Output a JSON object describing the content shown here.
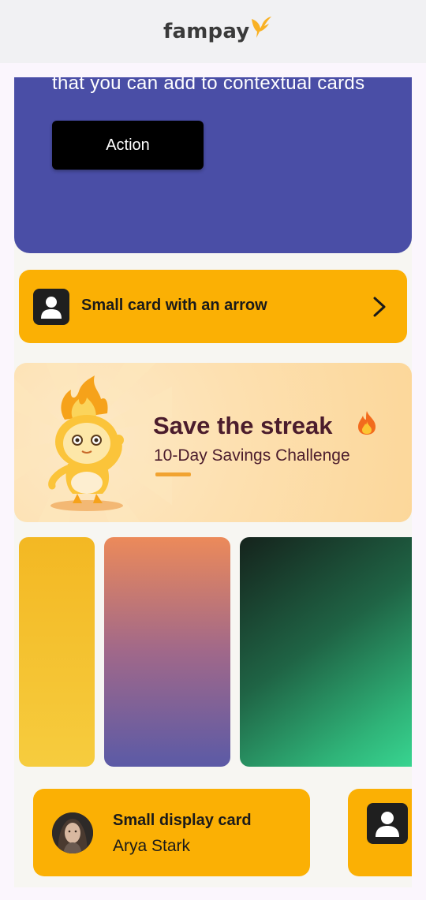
{
  "header": {
    "logo_text": "fampay",
    "logo_icon": "fampay-bird-icon",
    "accent_color": "#f9b123"
  },
  "big_display_card": {
    "text": "that you can add to contextual cards",
    "action_label": "Action",
    "background": "#4a4ea6"
  },
  "arrow_card": {
    "label": "Small card with an arrow",
    "icon": "user-icon",
    "arrow_icon": "chevron-right-icon",
    "background": "#fbb004"
  },
  "streak_banner": {
    "title": "Save the streak",
    "subtitle": "10-Day Savings Challenge",
    "emoji": "fire-icon",
    "title_color": "#4b1c2c"
  },
  "gradient_cards": [
    {
      "name": "yellow-gradient-card",
      "colors": [
        "#f3b823",
        "#f6cc3e"
      ]
    },
    {
      "name": "sunset-gradient-card",
      "colors": [
        "#ec8a5a",
        "#5b5aa6"
      ]
    },
    {
      "name": "green-gradient-card",
      "colors": [
        "#15231c",
        "#39d893"
      ]
    }
  ],
  "display_cards": [
    {
      "title": "Small display card",
      "subtitle": "Arya Stark",
      "icon": "avatar-photo"
    },
    {
      "title": "",
      "subtitle": "",
      "icon": "user-icon"
    }
  ]
}
